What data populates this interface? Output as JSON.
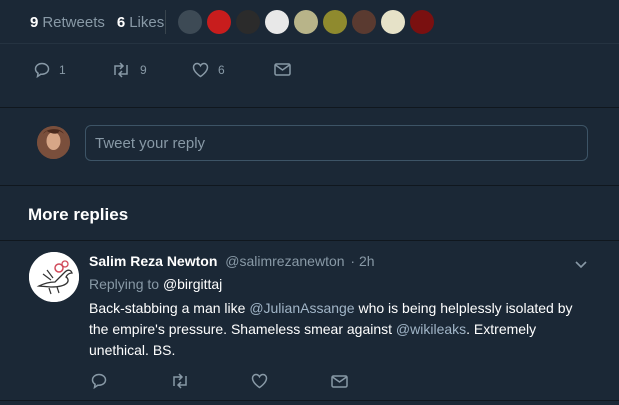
{
  "stats": {
    "retweets_count": "9",
    "retweets_label": "Retweets",
    "likes_count": "6",
    "likes_label": "Likes"
  },
  "liker_avatars": [
    "#3d4a55",
    "#c81d1d",
    "#2b2b2b",
    "#e8e8e8",
    "#b8b489",
    "#8f8a2e",
    "#5a3a30",
    "#e6e2c8",
    "#7a1010"
  ],
  "tweet_actions": {
    "reply_count": "1",
    "retweet_count": "9",
    "like_count": "6"
  },
  "compose": {
    "placeholder": "Tweet your reply"
  },
  "more_replies": {
    "title": "More replies"
  },
  "reply": {
    "display_name": "Salim Reza Newton",
    "handle": "@salimrezanewton",
    "time": "· 2h",
    "replying_prefix": "Replying to",
    "replying_to": "@birgittaj",
    "text_part1": "Back-stabbing a man like ",
    "mention1": "@JulianAssange",
    "text_part2": " who is being helplessly isolated by the empire's pressure. Shameless smear against ",
    "mention2": "@wikileaks",
    "text_part3": ". Extremely unethical. BS."
  },
  "colors": {
    "background": "#1b2836",
    "muted": "#8899a6",
    "link": "#a1b5c7"
  }
}
